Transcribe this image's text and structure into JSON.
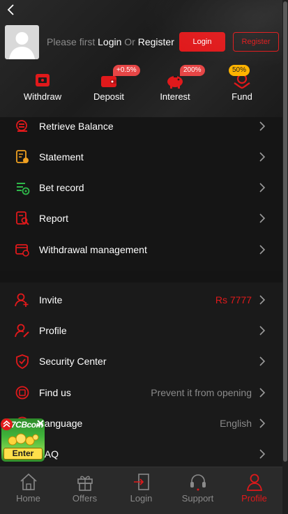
{
  "header": {
    "prompt_prefix": "Please first ",
    "login_link": "Login",
    "or_text": " Or ",
    "register_link": "Register",
    "login_button": "Login",
    "register_button": "Register"
  },
  "quick_actions": [
    {
      "label": "Withdraw",
      "icon": "withdraw-icon",
      "badge": ""
    },
    {
      "label": "Deposit",
      "icon": "wallet-icon",
      "badge": "+0.5%"
    },
    {
      "label": "Interest",
      "icon": "piggy-bank-icon",
      "badge": "200%"
    },
    {
      "label": "Fund",
      "icon": "fund-hand-icon",
      "badge": "50%"
    }
  ],
  "menu_primary": [
    {
      "label": "Retrieve Balance",
      "icon": "retrieve-balance-icon"
    },
    {
      "label": "Statement",
      "icon": "statement-icon"
    },
    {
      "label": "Bet record",
      "icon": "bet-record-icon"
    },
    {
      "label": "Report",
      "icon": "report-icon"
    },
    {
      "label": "Withdrawal management",
      "icon": "withdrawal-management-icon"
    }
  ],
  "menu_secondary": [
    {
      "label": "Invite",
      "value": "Rs 7777",
      "icon": "invite-icon"
    },
    {
      "label": "Profile",
      "value": "",
      "icon": "profile-edit-icon"
    },
    {
      "label": "Security Center",
      "value": "",
      "icon": "shield-icon"
    },
    {
      "label": "Find us",
      "value": "Prevent it from opening",
      "icon": "find-us-icon"
    },
    {
      "label": "Language",
      "value": "English",
      "icon": "language-icon"
    },
    {
      "label": "FAQ",
      "value": "",
      "icon": "faq-icon"
    }
  ],
  "floating_ad": {
    "brand": "7CBcom",
    "enter": "Enter"
  },
  "tabbar": [
    {
      "label": "Home",
      "icon": "home-icon",
      "active": false
    },
    {
      "label": "Offers",
      "icon": "gift-icon",
      "active": false
    },
    {
      "label": "Login",
      "icon": "login-door-icon",
      "active": false
    },
    {
      "label": "Support",
      "icon": "headset-icon",
      "active": false
    },
    {
      "label": "Profile",
      "icon": "user-icon",
      "active": true
    }
  ],
  "colors": {
    "accent": "#e0191b",
    "background": "#151515",
    "muted_text": "#8a8a8a"
  }
}
